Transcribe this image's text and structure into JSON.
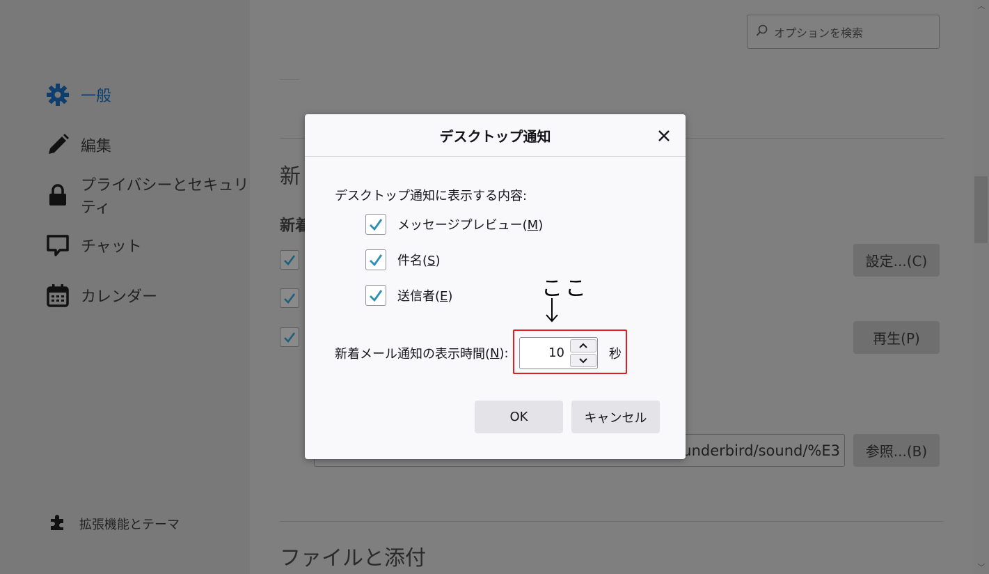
{
  "search": {
    "placeholder": "オプションを検索"
  },
  "sidebar": {
    "items": [
      {
        "label": "一般",
        "icon": "gear-icon",
        "active": true
      },
      {
        "label": "編集",
        "icon": "pencil-icon"
      },
      {
        "label": "プライバシーとセキュリティ",
        "icon": "lock-icon"
      },
      {
        "label": "チャット",
        "icon": "chat-icon"
      },
      {
        "label": "カレンダー",
        "icon": "calendar-icon"
      }
    ],
    "addons_label": "拡張機能とテーマ"
  },
  "background": {
    "section_heading_partial": "新",
    "subheading_partial": "新着",
    "settings_button": "設定...(C)",
    "play_button": "再生(P)",
    "sound_path": "underbird/sound/%E3",
    "browse_button": "参照...(B)",
    "files_heading": "ファイルと添付"
  },
  "dialog": {
    "title": "デスクトップ通知",
    "content_label": "デスクトップ通知に表示する内容:",
    "checkboxes": [
      {
        "label": "メッセージプレビュー(",
        "key": "M",
        "suffix": ")",
        "checked": true
      },
      {
        "label": "件名(",
        "key": "S",
        "suffix": ")",
        "checked": true
      },
      {
        "label": "送信者(",
        "key": "E",
        "suffix": ")",
        "checked": true
      }
    ],
    "time_label_pre": "新着メール通知の表示時間(",
    "time_label_key": "N",
    "time_label_post": "):",
    "time_value": "10",
    "time_unit": "秒",
    "ok_button": "OK",
    "cancel_button": "キャンセル"
  },
  "annotation": {
    "text": "ここ"
  },
  "colors": {
    "accent": "#0d3e6e",
    "check": "#2a8fb3",
    "highlight": "#e02020"
  }
}
